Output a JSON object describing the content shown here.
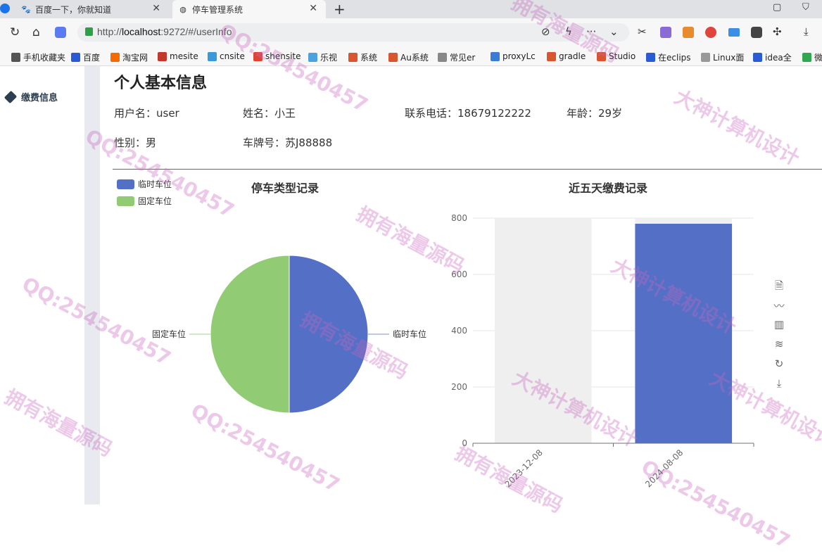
{
  "tabs": [
    {
      "label": "百度一下，你就知道",
      "active": false
    },
    {
      "label": "停车管理系统",
      "active": true
    }
  ],
  "address": {
    "prefix": "http://",
    "host": "localhost",
    "rest": ":9272/#/userInfo"
  },
  "bookmarks": [
    "手机收藏夹",
    "百度",
    "淘宝网",
    "mesite",
    "cnsite",
    "shensite",
    "乐视",
    "系统",
    "Au系统",
    "常见er",
    "proxyLc",
    "gradle",
    "Studio",
    "在eclips",
    "Linux面",
    "idea全",
    "微"
  ],
  "sidebar": {
    "items": [
      {
        "label": "缴费信息"
      }
    ]
  },
  "page": {
    "title": "个人基本信息",
    "fields": {
      "username": "用户名：user",
      "name": "姓名：小王",
      "phone": "联系电话：18679122222",
      "age": "年龄：29岁",
      "gender": "性别：男",
      "plate": "车牌号：苏J88888"
    }
  },
  "chart_data": [
    {
      "type": "pie",
      "title": "停车类型记录",
      "legend_position": "top-left",
      "slices": [
        {
          "label": "临时车位",
          "value": 50,
          "color": "#5470c6"
        },
        {
          "label": "固定车位",
          "value": 50,
          "color": "#91cc75"
        }
      ]
    },
    {
      "type": "bar",
      "title": "近五天缴费记录",
      "categories": [
        "2023-12-08",
        "2024-08-08"
      ],
      "values": [
        0,
        780
      ],
      "background_bars": true,
      "ylim": [
        0,
        800
      ],
      "yticks": [
        0,
        200,
        400,
        600,
        800
      ],
      "color": "#5470c6",
      "toolbox": [
        "data-view-icon",
        "line-icon",
        "bar-icon",
        "stack-icon",
        "restore-icon",
        "download-icon"
      ]
    }
  ],
  "watermarks": [
    "QQ:254540457",
    "拥有海量源码",
    "大神计算机设计"
  ]
}
